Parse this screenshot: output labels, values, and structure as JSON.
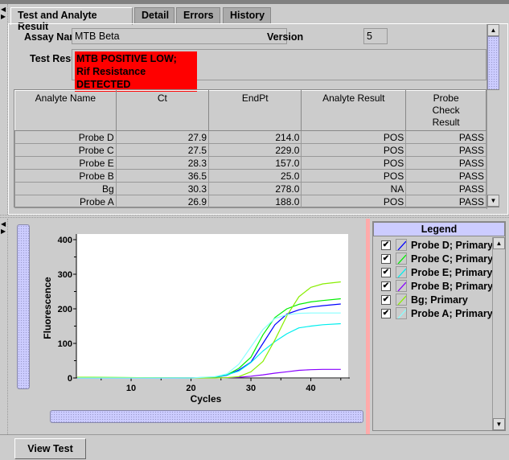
{
  "tabs": [
    {
      "label": "Test and Analyte Result",
      "selected": true
    },
    {
      "label": "Detail"
    },
    {
      "label": "Errors"
    },
    {
      "label": "History"
    }
  ],
  "assay": {
    "label": "Assay Name",
    "value": "MTB Beta",
    "version_label": "Version",
    "version": "5"
  },
  "test_result": {
    "label": "Test Result",
    "line1": "MTB POSITIVE LOW;",
    "line2": "Rif Resistance DETECTED",
    "highlight": "#ff0000"
  },
  "table": {
    "headers": [
      "Analyte Name",
      "Ct",
      "EndPt",
      "Analyte Result",
      "Probe Check Result"
    ],
    "rows": [
      [
        "Probe D",
        "27.9",
        "214.0",
        "POS",
        "PASS"
      ],
      [
        "Probe C",
        "27.5",
        "229.0",
        "POS",
        "PASS"
      ],
      [
        "Probe E",
        "28.3",
        "157.0",
        "POS",
        "PASS"
      ],
      [
        "Probe B",
        "36.5",
        "25.0",
        "POS",
        "PASS"
      ],
      [
        "Bg",
        "30.3",
        "278.0",
        "NA",
        "PASS"
      ],
      [
        "Probe A",
        "26.9",
        "188.0",
        "POS",
        "PASS"
      ]
    ]
  },
  "legend": {
    "title": "Legend",
    "items": [
      {
        "label": "Probe D; Primary",
        "color": "#0000ff",
        "checked": true
      },
      {
        "label": "Probe C; Primary",
        "color": "#00ee00",
        "checked": true
      },
      {
        "label": "Probe E; Primary",
        "color": "#00eeee",
        "checked": true
      },
      {
        "label": "Probe B; Primary",
        "color": "#8800ff",
        "checked": true
      },
      {
        "label": "Bg; Primary",
        "color": "#88ee00",
        "checked": true
      },
      {
        "label": "Probe A; Primary",
        "color": "#88ffff",
        "checked": true
      }
    ]
  },
  "chart_data": {
    "type": "line",
    "xlabel": "Cycles",
    "ylabel": "Fluorescence",
    "xlim": [
      1,
      46
    ],
    "ylim": [
      0,
      400
    ],
    "xticks": [
      "10",
      "20",
      "30",
      "40"
    ],
    "yticks": [
      "0",
      "100",
      "200",
      "300",
      "400"
    ],
    "grid": false,
    "x": [
      1,
      20,
      24,
      26,
      28,
      30,
      32,
      34,
      36,
      38,
      40,
      42,
      45
    ],
    "series": [
      {
        "name": "Probe D; Primary",
        "color": "#0000ff",
        "values": [
          0,
          0,
          2,
          8,
          23,
          46,
          100,
          154,
          185,
          197,
          205,
          209,
          214
        ]
      },
      {
        "name": "Probe C; Primary",
        "color": "#00ee00",
        "values": [
          2,
          0,
          2,
          9,
          28,
          60,
          125,
          175,
          200,
          213,
          220,
          224,
          229
        ]
      },
      {
        "name": "Probe E; Primary",
        "color": "#00eeee",
        "values": [
          0,
          0,
          3,
          9,
          20,
          45,
          78,
          105,
          128,
          145,
          150,
          154,
          157
        ]
      },
      {
        "name": "Probe B; Primary",
        "color": "#8800ff",
        "values": [
          0,
          0,
          0,
          1,
          2,
          5,
          9,
          14,
          18,
          22,
          24,
          25,
          25
        ]
      },
      {
        "name": "Bg; Primary",
        "color": "#88ee00",
        "values": [
          2,
          0,
          0,
          1,
          4,
          18,
          48,
          110,
          180,
          235,
          262,
          272,
          278
        ]
      },
      {
        "name": "Probe A; Primary",
        "color": "#88ffff",
        "values": [
          0,
          0,
          4,
          12,
          40,
          90,
          140,
          172,
          183,
          187,
          188,
          188,
          188
        ]
      }
    ]
  },
  "buttons": {
    "view_test": "View Test"
  }
}
